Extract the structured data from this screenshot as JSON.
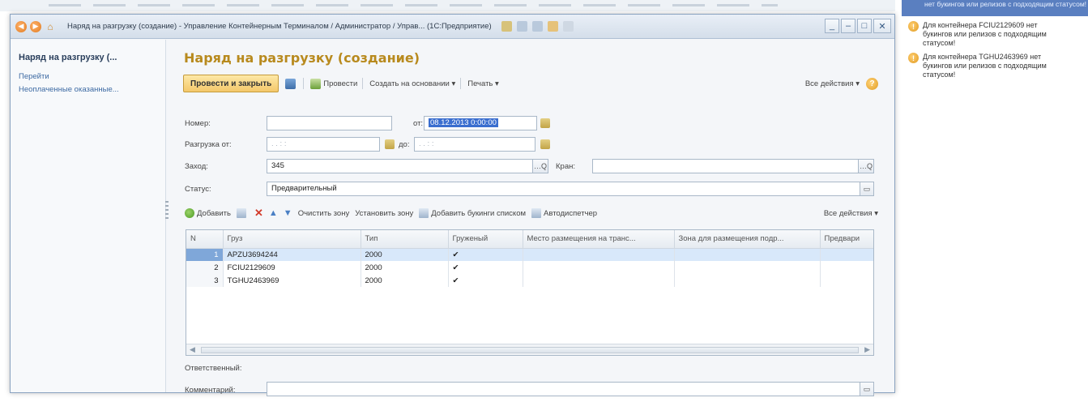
{
  "window": {
    "title": "Наряд на разгрузку (создание) - Управление Контейнерным Терминалом / Администратор / Управ... (1С:Предприятие)"
  },
  "leftnav": {
    "title": "Наряд на разгрузку (...",
    "links": [
      "Перейти",
      "Неоплаченные оказанные..."
    ]
  },
  "form": {
    "title": "Наряд на разгрузку (создание)",
    "toolbar": {
      "post_close": "Провести и закрыть",
      "post": "Провести",
      "create_based": "Создать на основании ▾",
      "print": "Печать ▾",
      "all_actions": "Все действия ▾",
      "help": "?"
    },
    "number_label": "Номер:",
    "number_value": "",
    "from_label": "от:",
    "date_value": "08.12.2013 0:00:00",
    "unload_label": "Разгрузка от:",
    "unload_from_placeholder": ". .   : :",
    "to_label": "до:",
    "unload_to_placeholder": ". .   : :",
    "call_label": "Заход:",
    "call_value": "345",
    "crane_label": "Кран:",
    "crane_value": "",
    "status_label": "Статус:",
    "status_value": "Предварительный",
    "responsible_label": "Ответственный:",
    "comment_label": "Комментарий:",
    "comment_value": ""
  },
  "table_toolbar": {
    "add": "Добавить",
    "clear_zone": "Очистить зону",
    "set_zone": "Установить зону",
    "add_bookings": "Добавить букинги списком",
    "auto_dispatcher": "Автодиспетчер",
    "all_actions": "Все действия ▾"
  },
  "grid": {
    "columns": [
      "N",
      "Груз",
      "Тип",
      "Груженый",
      "Место размещения на транс...",
      "Зона для размещения подр...",
      "Предвари"
    ],
    "rows": [
      {
        "n": "1",
        "cargo": "APZU3694244",
        "type": "2000",
        "loaded": "✔",
        "place": "",
        "zone": "",
        "pre": ""
      },
      {
        "n": "2",
        "cargo": "FCIU2129609",
        "type": "2000",
        "loaded": "✔",
        "place": "",
        "zone": "",
        "pre": ""
      },
      {
        "n": "3",
        "cargo": "TGHU2463969",
        "type": "2000",
        "loaded": "✔",
        "place": "",
        "zone": "",
        "pre": ""
      }
    ]
  },
  "notifications": {
    "top_fragment": "нет букингов или релизов с подходящим статусом!",
    "messages": [
      "Для контейнера FCIU2129609 нет букингов или релизов с подходящим статусом!",
      "Для контейнера TGHU2463969 нет букингов или релизов с подходящим статусом!"
    ]
  }
}
